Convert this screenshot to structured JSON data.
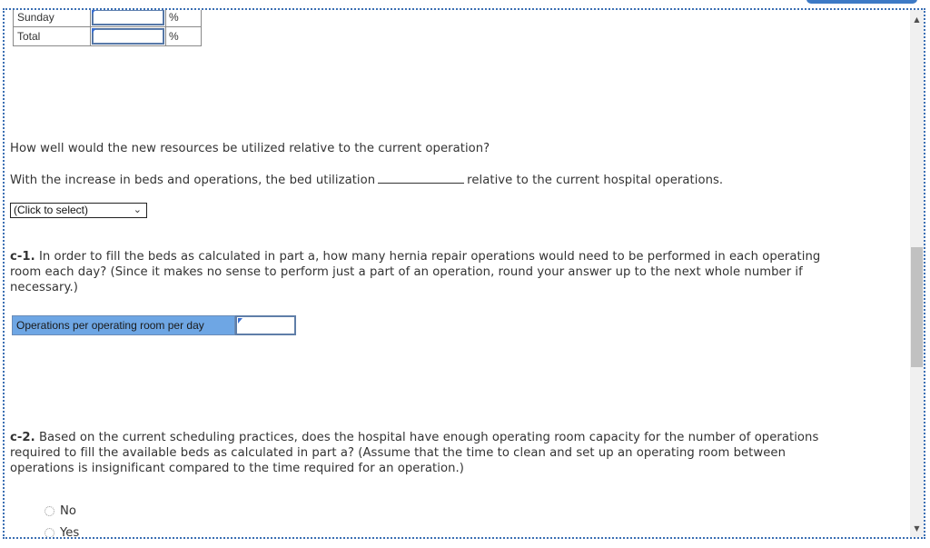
{
  "table": {
    "rows": [
      {
        "label": "Sunday",
        "value": "",
        "unit": "%"
      },
      {
        "label": "Total",
        "value": "",
        "unit": "%"
      }
    ]
  },
  "question_b": {
    "prompt": "How well would the new resources be utilized relative to the current operation?",
    "sentence_before": "With the increase in beds and operations, the bed utilization",
    "sentence_after": "relative to the current hospital operations.",
    "select": {
      "selected": "(Click to select)"
    }
  },
  "question_c1": {
    "label": "c-1.",
    "text": "In order to fill the beds as calculated in part a, how many hernia repair operations would need to be performed in each operating room each day? (Since it makes no sense to perform just a part of an operation, round your answer up to the next whole number if necessary.)",
    "input_label": "Operations per operating room per day",
    "input_value": ""
  },
  "question_c2": {
    "label": "c-2.",
    "text": "Based on the current scheduling practices, does the hospital have enough operating room capacity for the number of operations required to fill the available beds as calculated in part a? (Assume that the time to clean and set up an operating room between operations is insignificant compared to the time required for an operation.)",
    "options": [
      "No",
      "Yes"
    ]
  },
  "scrollbar": {
    "up_icon": "▲",
    "down_icon": "▼",
    "position_fraction": 0.45
  },
  "colors": {
    "accent": "#3d7ac6",
    "label_bg": "#6ea6e4"
  }
}
